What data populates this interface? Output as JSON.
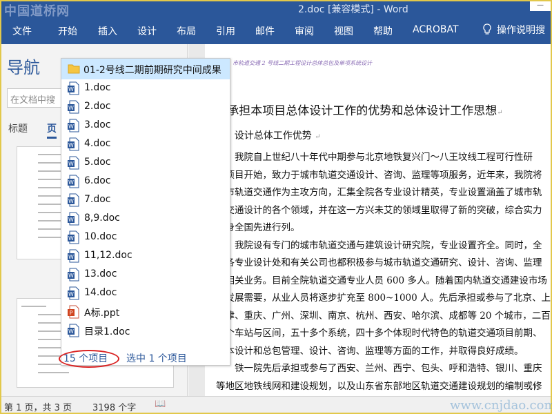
{
  "title_bar": {
    "watermark": "中国道桥网",
    "doc_title": "2.doc [兼容模式] - Word"
  },
  "ribbon": {
    "tabs": [
      "文件",
      "开始",
      "插入",
      "设计",
      "布局",
      "引用",
      "邮件",
      "审阅",
      "视图",
      "帮助",
      "ACROBAT"
    ],
    "help_label": "操作说明搜"
  },
  "nav_pane": {
    "title": "导航",
    "search_placeholder": "在文档中搜",
    "tabs": [
      "标题",
      "页"
    ]
  },
  "file_list": {
    "folder": "01-2号线二期前期研究中间成果",
    "files": [
      {
        "name": "1.doc",
        "type": "word"
      },
      {
        "name": "2.doc",
        "type": "word"
      },
      {
        "name": "3.doc",
        "type": "word"
      },
      {
        "name": "4.doc",
        "type": "word"
      },
      {
        "name": "5.doc",
        "type": "word"
      },
      {
        "name": "6.doc",
        "type": "word"
      },
      {
        "name": "7.doc",
        "type": "word"
      },
      {
        "name": "8,9.doc",
        "type": "word"
      },
      {
        "name": "10.doc",
        "type": "word"
      },
      {
        "name": "11,12.doc",
        "type": "word"
      },
      {
        "name": "13.doc",
        "type": "word"
      },
      {
        "name": "14.doc",
        "type": "word"
      },
      {
        "name": "A标.ppt",
        "type": "ppt"
      },
      {
        "name": "目录1.doc",
        "type": "word"
      }
    ],
    "item_count": "15 个项目",
    "selected": "选中 1 个项目"
  },
  "document": {
    "header_italic": "市轨道交通 2 号线二期工程设计总体总包及单项系统设计",
    "heading": "2 承担本项目总体设计工作的优势和总体设计工作思想",
    "subheading": "2.1 设计总体工作优势",
    "lines": [
      "　　我院自上世纪八十年代中期参与北京地铁复兴门～八王坟线工程可行性研",
      "究项目开始，致力于城市轨道交通设计、咨询、监理等项服务，近年来，我院将",
      "城市轨道交通作为主攻方向，汇集全院各专业设计精英，专业设置涵盖了城市轨",
      "道交通设计的各个领域，并在这一方兴未艾的领域里取得了新的突破，综合实力",
      "跻身全国先进行列。",
      "　　我院设有专门的城市轨道交通与建筑设计研究院，专业设置齐全。同时，全",
      "院各专业设计处和有关公司也都积极参与城市轨道交通研究、设计、咨询、监理",
      "等相关业务。目前全院轨道交通专业人员 600 多人。随着国内轨道交通建设市场",
      "的发展需要，从业人员将逐步扩充至 800~1000 人。先后承担或参与了北京、上海",
      "天津、重庆、广州、深圳、南京、杭州、西安、哈尔滨、成都等 20 个城市，二百",
      "多个车站与区间，五十多个系统，四十多个体现时代特色的轨道交通项目前期、",
      "　本设计和总包管理、设计、咨询、监理等方面的工作，并取得良好成绩。",
      "　　铁一院先后承担或参与了西安、兰州、西宁、包头、呼和浩特、银川、重庆",
      "等地区地铁线网和建设规划，以及山东省东部地区轨道交通建设规划的编制或修"
    ]
  },
  "status_bar": {
    "page": "第 1 页，共 3 页",
    "words": "3198 个字",
    "watermark": "www.cnjdao.com"
  },
  "colors": {
    "ribbon": "#2b579a",
    "selection": "#cce8ff",
    "annotation": "#d92020"
  }
}
